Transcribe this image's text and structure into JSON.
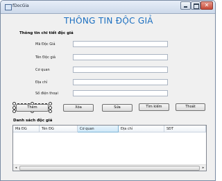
{
  "window": {
    "title": "fDocGia",
    "controls": {
      "minimize": "minimize-icon",
      "maximize": "maximize-icon",
      "close": "close-icon"
    },
    "close_glyph": "✕"
  },
  "header": {
    "title": "THÔNG TIN ĐỘC GIẢ",
    "color": "#1a6ec0"
  },
  "details": {
    "section_label": "Thông tin chi tiết độc giả",
    "fields": [
      {
        "label": "Mã Độc Giả",
        "value": ""
      },
      {
        "label": "Tên Độc giả",
        "value": ""
      },
      {
        "label": "Cơ quan",
        "value": ""
      },
      {
        "label": "Địa chỉ",
        "value": ""
      },
      {
        "label": "Số điện thoại",
        "value": ""
      }
    ]
  },
  "actions": {
    "add": "Thêm",
    "delete": "Xóa",
    "edit": "Sửa",
    "search": "Tìm kiếm",
    "exit": "Thoát"
  },
  "list": {
    "section_label": "Danh sách độc giả",
    "columns": [
      "Mã ĐG",
      "Tên ĐG",
      "Cơ quan",
      "Địa chỉ",
      "SĐT"
    ],
    "rows": [],
    "scroll_left": "◂",
    "scroll_right": "▸"
  }
}
